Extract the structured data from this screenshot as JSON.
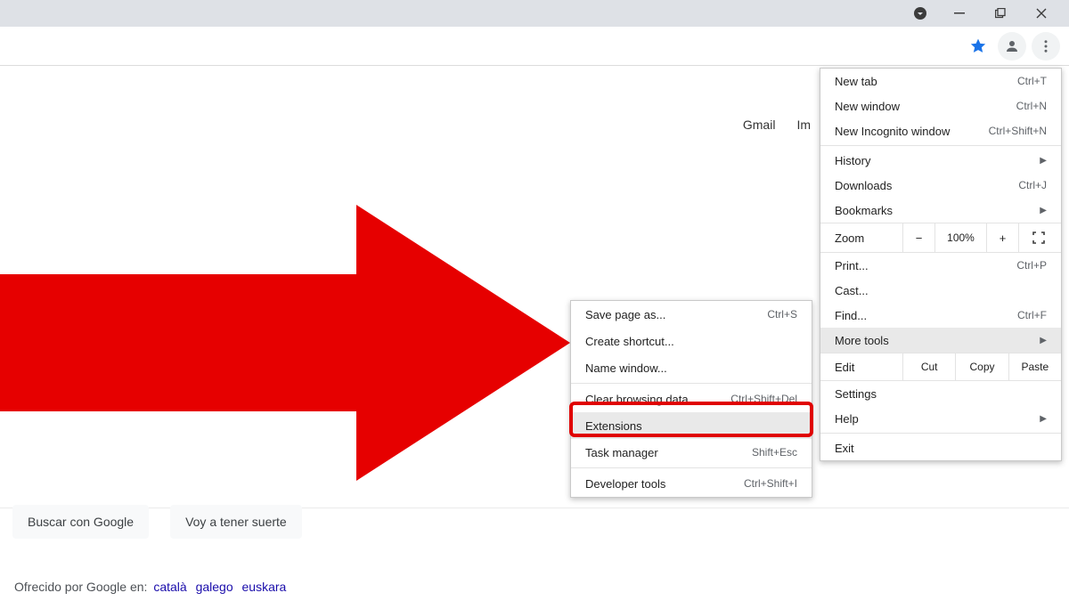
{
  "titlebar": {
    "indicator": "▾"
  },
  "page_links": {
    "gmail": "Gmail",
    "images_truncated": "Im"
  },
  "buttons": {
    "search": "Buscar con Google",
    "lucky": "Voy a tener suerte"
  },
  "offer": {
    "prefix": "Ofrecido por Google en:",
    "langs": [
      "català",
      "galego",
      "euskara"
    ]
  },
  "menu": {
    "new_tab": "New tab",
    "new_tab_sc": "Ctrl+T",
    "new_window": "New window",
    "new_window_sc": "Ctrl+N",
    "incognito": "New Incognito window",
    "incognito_sc": "Ctrl+Shift+N",
    "history": "History",
    "downloads": "Downloads",
    "downloads_sc": "Ctrl+J",
    "bookmarks": "Bookmarks",
    "zoom": "Zoom",
    "zoom_minus": "−",
    "zoom_val": "100%",
    "zoom_plus": "+",
    "print": "Print...",
    "print_sc": "Ctrl+P",
    "cast": "Cast...",
    "find": "Find...",
    "find_sc": "Ctrl+F",
    "more_tools": "More tools",
    "edit": "Edit",
    "cut": "Cut",
    "copy": "Copy",
    "paste": "Paste",
    "settings": "Settings",
    "help": "Help",
    "exit": "Exit"
  },
  "submenu": {
    "save_as": "Save page as...",
    "save_as_sc": "Ctrl+S",
    "create_shortcut": "Create shortcut...",
    "name_window": "Name window...",
    "clear_data": "Clear browsing data...",
    "clear_data_sc": "Ctrl+Shift+Del",
    "extensions": "Extensions",
    "task_manager": "Task manager",
    "task_manager_sc": "Shift+Esc",
    "devtools": "Developer tools",
    "devtools_sc": "Ctrl+Shift+I"
  }
}
